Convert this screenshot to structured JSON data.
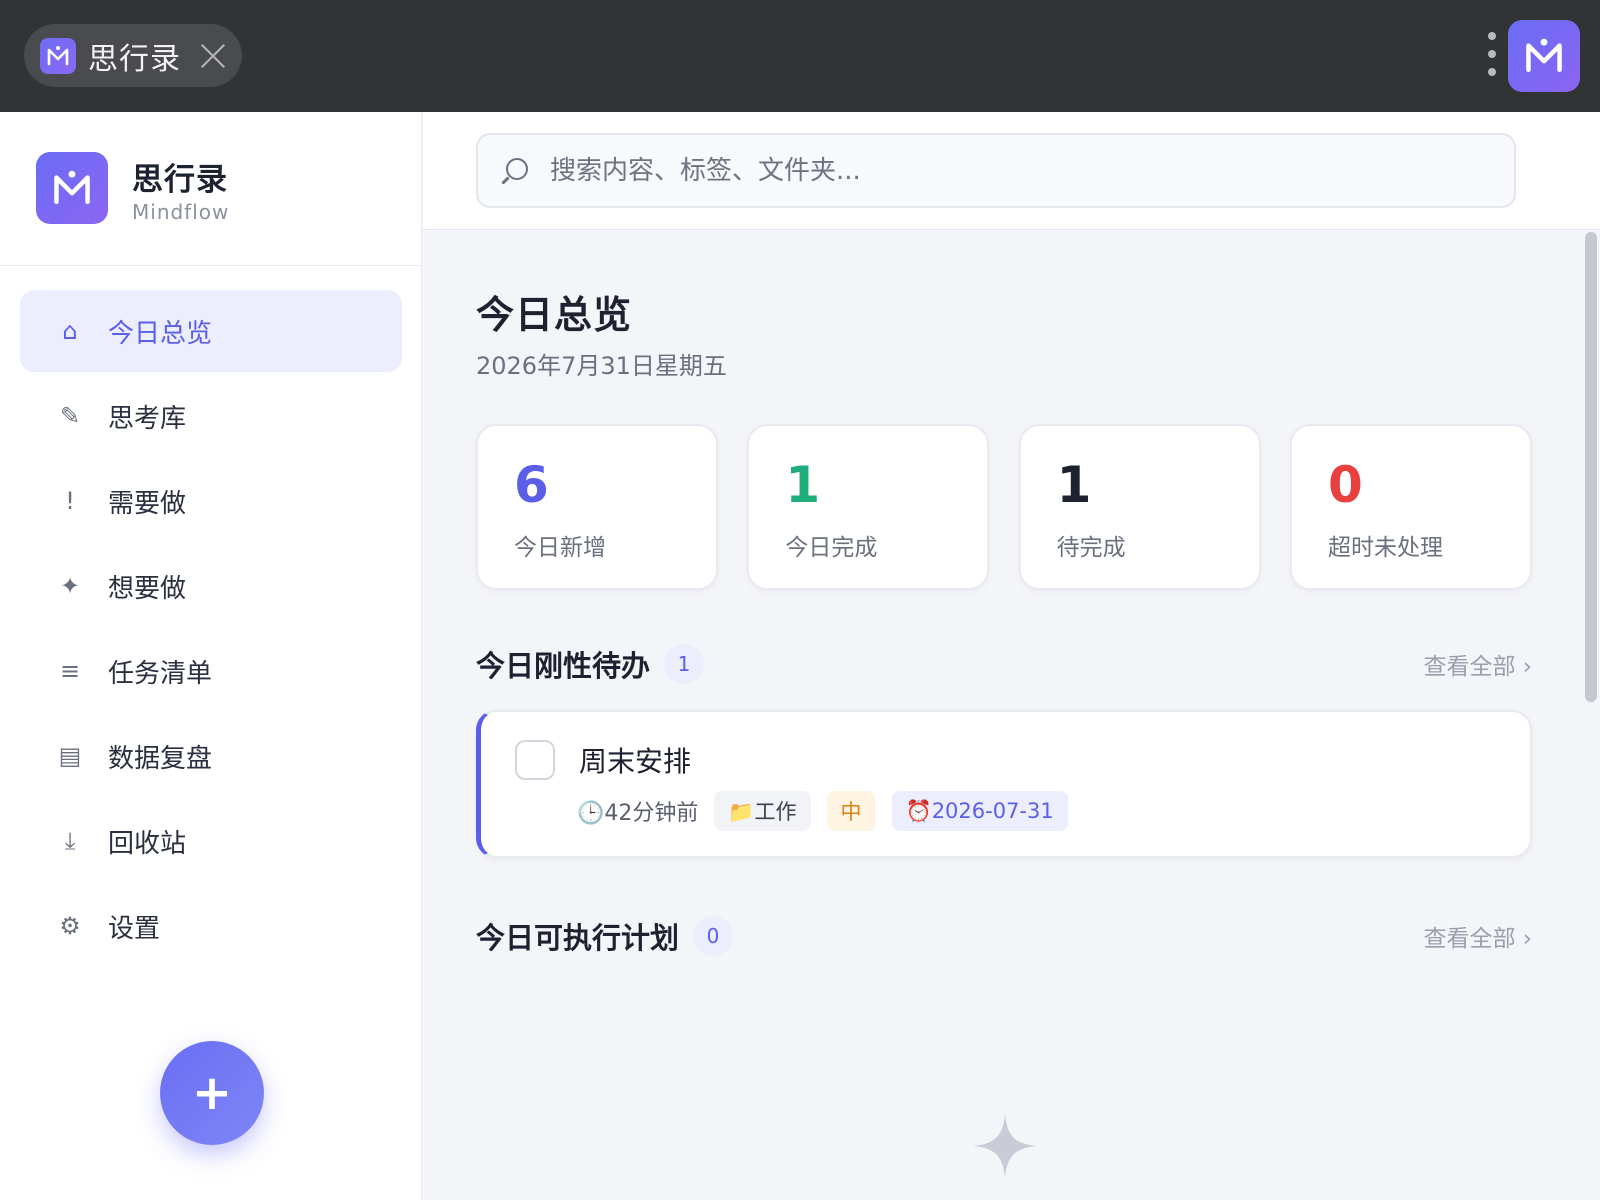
{
  "window": {
    "tab_title": "思行录"
  },
  "brand": {
    "name": "思行录",
    "subtitle": "Mindflow"
  },
  "sidebar": {
    "items": [
      {
        "label": "今日总览",
        "icon": "⌂",
        "icon_name": "home-icon",
        "active": true
      },
      {
        "label": "思考库",
        "icon": "✎",
        "icon_name": "pencil-icon",
        "active": false
      },
      {
        "label": "需要做",
        "icon": "!",
        "icon_name": "exclamation-icon",
        "active": false
      },
      {
        "label": "想要做",
        "icon": "✦",
        "icon_name": "sparkle-icon",
        "active": false
      },
      {
        "label": "任务清单",
        "icon": "≡",
        "icon_name": "list-icon",
        "active": false
      },
      {
        "label": "数据复盘",
        "icon": "▤",
        "icon_name": "data-icon",
        "active": false
      },
      {
        "label": "回收站",
        "icon": "⤓",
        "icon_name": "recycle-icon",
        "active": false
      },
      {
        "label": "设置",
        "icon": "⚙",
        "icon_name": "gear-icon",
        "active": false
      }
    ],
    "fab_label": "+"
  },
  "search": {
    "placeholder": "搜索内容、标签、文件夹...",
    "value": ""
  },
  "main": {
    "title": "今日总览",
    "date": "2026年7月31日星期五",
    "stats": [
      {
        "value": "6",
        "label": "今日新增",
        "color": "#5b5fe8"
      },
      {
        "value": "1",
        "label": "今日完成",
        "color": "#1fae7a"
      },
      {
        "value": "1",
        "label": "待完成",
        "color": "#1d2130"
      },
      {
        "value": "0",
        "label": "超时未处理",
        "color": "#e8403f"
      }
    ],
    "sections": [
      {
        "title": "今日刚性待办",
        "count": "1",
        "link": "查看全部 ›"
      },
      {
        "title": "今日可执行计划",
        "count": "0",
        "link": "查看全部 ›"
      }
    ],
    "task": {
      "title": "周末安排",
      "time": "🕒42分钟前",
      "folder": "📁工作",
      "priority": "中",
      "due": "⏰2026-07-31"
    }
  },
  "colors": {
    "accent": "#5b5fe8",
    "success": "#1fae7a",
    "danger": "#e8403f",
    "warning": "#d68514"
  }
}
